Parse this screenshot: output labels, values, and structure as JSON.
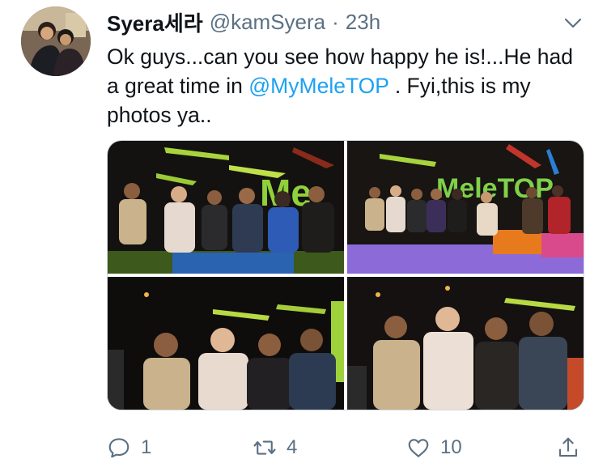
{
  "tweet": {
    "display_name": "Syera세라",
    "handle": "@kamSyera",
    "separator": "·",
    "time": "23h",
    "text_part1": "Ok guys...can you see how happy he is!...He had a great time in ",
    "mention": "@MyMeleTOP",
    "text_part2": " . Fyi,this is my photos ya..",
    "menu_icon": "chevron-down-icon",
    "accent_color": "#1da1f2",
    "muted_color": "#5b7083"
  },
  "media": {
    "photo_count": 4,
    "studio_sign_text_1": "Me",
    "studio_sign_text_2": "MeleTOP"
  },
  "actions": {
    "reply": {
      "icon": "reply-icon",
      "count": "1"
    },
    "retweet": {
      "icon": "retweet-icon",
      "count": "4"
    },
    "like": {
      "icon": "heart-icon",
      "count": "10"
    },
    "share": {
      "icon": "share-icon",
      "count": ""
    }
  }
}
